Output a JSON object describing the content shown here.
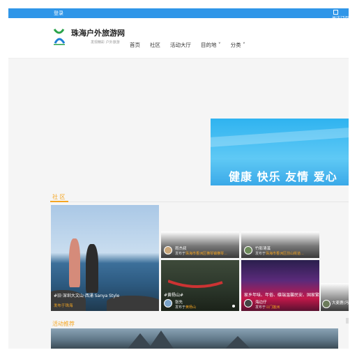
{
  "topbar": {
    "login_label": "登录",
    "follow_label": "关注订阅"
  },
  "header": {
    "site_name": "珠海户外旅游网",
    "slogan": "发现精彩 户外旅游",
    "nav": [
      {
        "label": "首页"
      },
      {
        "label": "社区"
      },
      {
        "label": "活动大厅"
      },
      {
        "label": "目的地 ˅"
      },
      {
        "label": "分类 ˅"
      }
    ]
  },
  "banner": {
    "text": "健康 快乐 友情 爱心"
  },
  "community": {
    "title": "社 区",
    "featured": {
      "caption": "#旧·深圳大文山·西涌 Sanya Style",
      "sub": "发布于珠海"
    },
    "posts": [
      {
        "user": "雨杰叔",
        "pub_prefix": "发布于",
        "pub_place": "珠海市香洲区横琴镇横琴..."
      },
      {
        "user": "竹影清溪",
        "pub_prefix": "发布于",
        "pub_place": "珠海市香洲区前山街道..."
      },
      {
        "text": "#黄杨山#",
        "user": "张先",
        "pub_prefix": "发布于",
        "pub_place": "黄杨山"
      },
      {
        "text": "家乡年味、年俗、碟端温馨民安、国家繁...",
        "user": "海边仔",
        "pub_prefix": "发布于",
        "pub_place": "斗门莲洲"
      },
      {
        "user": "大麦鹿(冯"
      }
    ]
  },
  "activity": {
    "title": "活动推荐"
  }
}
